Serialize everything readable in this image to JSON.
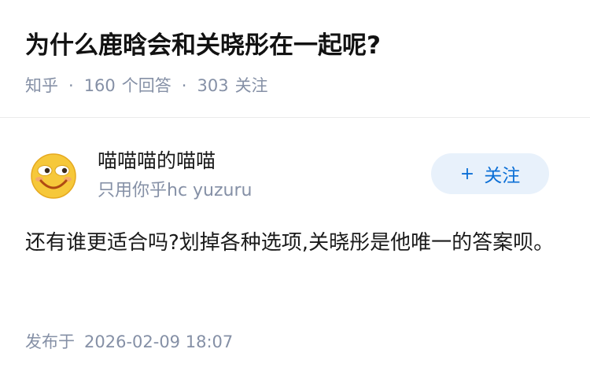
{
  "question": {
    "title": "为什么鹿晗会和关晓彤在一起呢?",
    "source": "知乎",
    "answer_count": "160",
    "answer_label": "个回答",
    "follower_count": "303",
    "follower_label": "关注"
  },
  "answer": {
    "author": {
      "name": "喵喵喵的喵喵",
      "bio": "只用你乎hc yuzuru",
      "avatar_icon": "smiley-face-avatar"
    },
    "follow_button": {
      "icon": "plus-icon",
      "label": "关注"
    },
    "content": "还有谁更适合吗?划掉各种选项,关晓彤是他唯一的答案呗。",
    "publish_label": "发布于",
    "publish_time": "2026-02-09 18:07"
  },
  "colors": {
    "accent": "#0b6fd6",
    "button_bg": "#e8f1fb",
    "meta_gray": "#8590a6",
    "avatar_yellow": "#f6c83a"
  }
}
